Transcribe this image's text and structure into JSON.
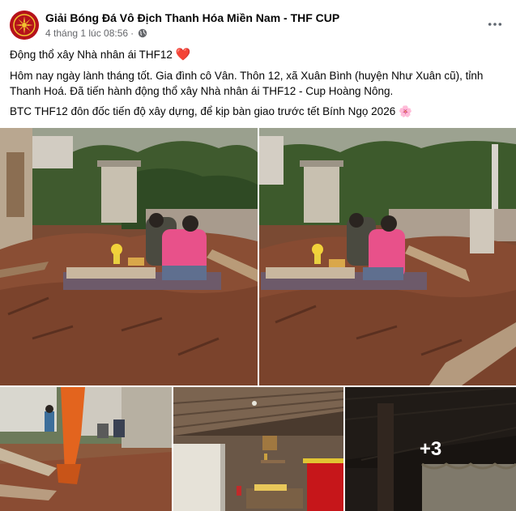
{
  "post": {
    "page_name": "Giải Bóng Đá Vô Địch Thanh Hóa Miền Nam - THF CUP",
    "timestamp": "4 tháng 1 lúc 08:56",
    "separator": "·",
    "privacy_icon": "globe-icon",
    "more_icon": "more-horizontal-icon"
  },
  "content": {
    "line1": "Động thổ xây Nhà nhân ái THF12",
    "line1_emoji": "❤️",
    "paragraph2": "Hôm nay ngày lành tháng tốt. Gia đình cô Vân. Thôn 12, xã Xuân Bình (huyện Như Xuân cũ), tỉnh Thanh Hoá. Đã tiến hành động thổ xây Nhà nhân ái THF12 - Cup Hoàng Nông.",
    "paragraph3": "BTC THF12 đôn đốc tiến độ xây dựng, để kịp bàn giao trước tết Bính Ngọ 2026",
    "paragraph3_emoji": "🌸"
  },
  "photos": {
    "more_count_label": "+3"
  },
  "colors": {
    "meta_text": "#65676b",
    "avatar": "#c8102e",
    "heart": "#e41e3f"
  }
}
